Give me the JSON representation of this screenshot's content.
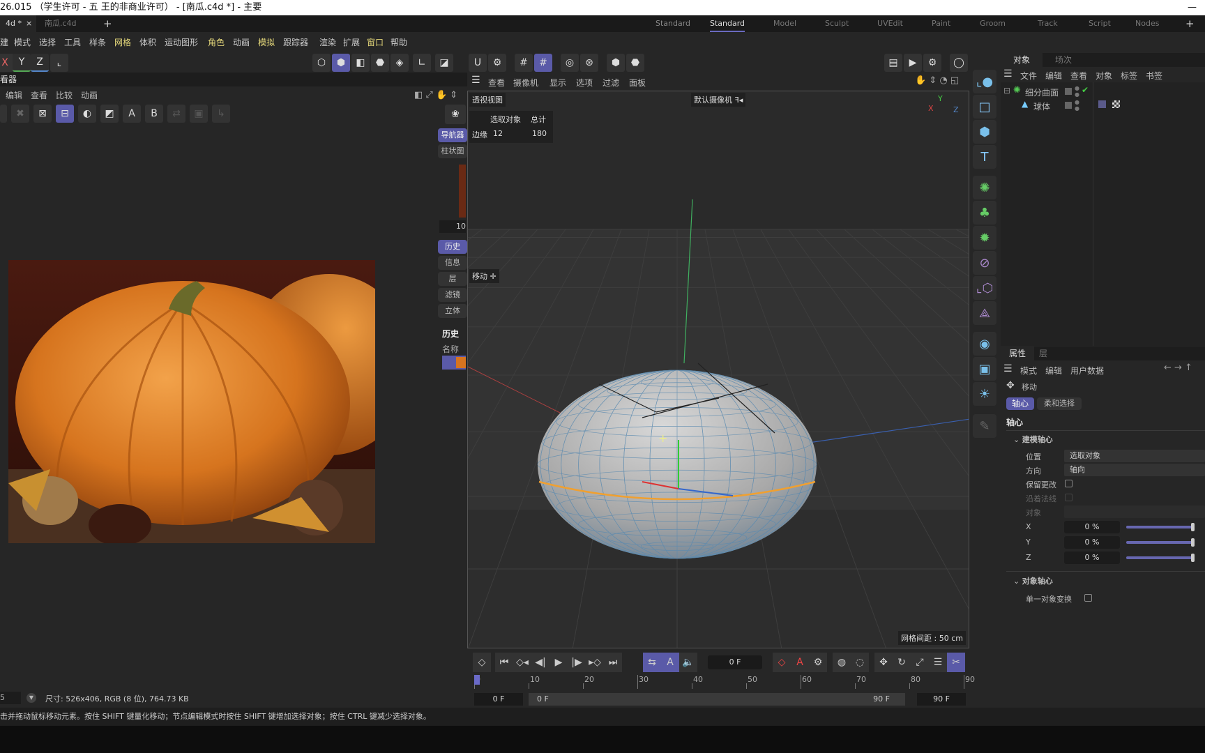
{
  "window": {
    "title": "26.015 （学生许可 - 五 王的非商业许可） - [南瓜.c4d *] - 主要",
    "minimize": "—"
  },
  "file_tabs": [
    {
      "label": "4d *",
      "close": "×"
    },
    {
      "label": "南瓜.c4d",
      "close": ""
    }
  ],
  "new_tab": "+",
  "layouts": [
    "Standard",
    "Model",
    "Sculpt",
    "UVEdit",
    "Paint",
    "Groom",
    "Track",
    "Script",
    "Nodes"
  ],
  "layout_active": "Standard",
  "layout_add": "+",
  "menu": [
    {
      "l": "建",
      "hl": false
    },
    {
      "l": "模式",
      "hl": false
    },
    {
      "l": "选择",
      "hl": false
    },
    {
      "l": "工具",
      "hl": false
    },
    {
      "l": "样条",
      "hl": false
    },
    {
      "l": "网格",
      "hl": true
    },
    {
      "l": "体积",
      "hl": false
    },
    {
      "l": "运动图形",
      "hl": false
    },
    {
      "l": "角色",
      "hl": true
    },
    {
      "l": "动画",
      "hl": false
    },
    {
      "l": "模拟",
      "hl": true
    },
    {
      "l": "跟踪器",
      "hl": false
    },
    {
      "l": "渲染",
      "hl": false
    },
    {
      "l": "扩展",
      "hl": false
    },
    {
      "l": "窗口",
      "hl": true
    },
    {
      "l": "帮助",
      "hl": false
    }
  ],
  "axis_toolbar": [
    "X",
    "Y",
    "Z"
  ],
  "picture_viewer": {
    "title": "看器",
    "menu": [
      "编辑",
      "查看",
      "比较",
      "动画"
    ],
    "tools_ab": [
      "A",
      "B"
    ],
    "nav_tabs": [
      "导航器",
      "柱状图"
    ],
    "zoom_value": "10",
    "side_tabs": [
      "历史",
      "信息",
      "层",
      "滤镜",
      "立体"
    ],
    "side_active": "历史",
    "history_title": "历史",
    "history_col": "名称",
    "zoom_field": "5",
    "info": "尺寸: 526x406, RGB (8 位), 764.73 KB"
  },
  "viewport": {
    "menu": [
      "查看",
      "摄像机",
      "显示",
      "选项",
      "过滤",
      "面板"
    ],
    "view_name": "透视视图",
    "camera": "默认摄像机",
    "camera_icon": "ꟻ◂",
    "stats": {
      "col1": "选取对象",
      "col2": "总计",
      "row_label": "边缘",
      "selected": "12",
      "total": "180"
    },
    "tool_hud": "移动",
    "grid_spacing": "网格间距 : 50 cm",
    "axis_labels": [
      "X",
      "Y",
      "Z"
    ]
  },
  "object_manager": {
    "tabs": [
      "对象",
      "场次"
    ],
    "menu": [
      "文件",
      "编辑",
      "查看",
      "对象",
      "标签",
      "书签"
    ],
    "objects": [
      {
        "name": "细分曲面",
        "color": "#e08a3a"
      },
      {
        "name": "球体",
        "color": "#e8c24a"
      }
    ]
  },
  "attributes": {
    "tabs": [
      "属性",
      "层"
    ],
    "menu": [
      "模式",
      "编辑",
      "用户数据"
    ],
    "tool": "移动",
    "subtabs": [
      "轴心",
      "柔和选择"
    ],
    "section": "轴心",
    "group1": "建模轴心",
    "position_label": "位置",
    "position_value": "选取对象",
    "orientation_label": "方向",
    "orientation_value": "轴向",
    "keep_changes": "保留更改",
    "along_normals": "沿着法线",
    "object_label": "对象",
    "axes": [
      {
        "label": "X",
        "value": "0 %"
      },
      {
        "label": "Y",
        "value": "0 %"
      },
      {
        "label": "Z",
        "value": "0 %"
      }
    ],
    "group2": "对象轴心",
    "single_transform": "单一对象变换"
  },
  "timeline": {
    "current_frame": "0 F",
    "ruler": [
      "0",
      "10",
      "20",
      "30",
      "40",
      "50",
      "60",
      "70",
      "80",
      "90"
    ],
    "start": "0 F",
    "range_start": "0 F",
    "range_end": "90 F",
    "end": "90 F"
  },
  "status": "击并拖动鼠标移动元素。按住 SHIFT 键量化移动；节点编辑模式时按住 SHIFT 键增加选择对象；按住 CTRL 键减少选择对象。",
  "colors": {
    "accent": "#5a5aa8",
    "object_orange": "#e08a3a",
    "selection_edge": "#f0a030"
  }
}
